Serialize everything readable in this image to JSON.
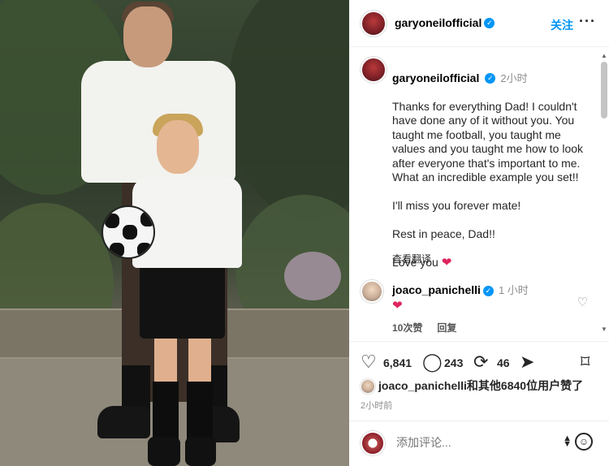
{
  "post": {
    "author": "garyoneilofficial",
    "follow_label": "关注",
    "more_label": "···"
  },
  "caption": {
    "author": "garyoneilofficial",
    "time": "2小时",
    "text": "Thanks for everything Dad! I couldn't have done any of it without you. You taught me football, you taught me values and you taught me how to look after everyone that's important to me. What an incredible example you set!!\n\nI'll miss you forever mate!\n\nRest in peace, Dad!!\n\nLove you",
    "heart": "❤",
    "translate_label": "查看翻译"
  },
  "comment": {
    "author": "joaco_panichelli",
    "time": "1 小时",
    "text": "❤",
    "likes_label": "10次赞",
    "reply_label": "回复"
  },
  "actions": {
    "likes": "6,841",
    "comments": "243",
    "reposts": "46"
  },
  "liked_by": {
    "text": "joaco_panichelli和其他6840位用户赞了"
  },
  "posted_time": "2小时前",
  "add_comment": {
    "placeholder": "添加评论..."
  },
  "icons": {
    "verified": "✓",
    "like": "♡",
    "comment": "◯",
    "repost": "⟳",
    "share": "➤",
    "save": "⌑",
    "emoji": "☺",
    "scroll_up": "▲",
    "scroll_down": "▼"
  },
  "colors": {
    "link_blue": "#0095f6",
    "heart_red": "#e0245e",
    "muted": "#8e8e8e"
  }
}
